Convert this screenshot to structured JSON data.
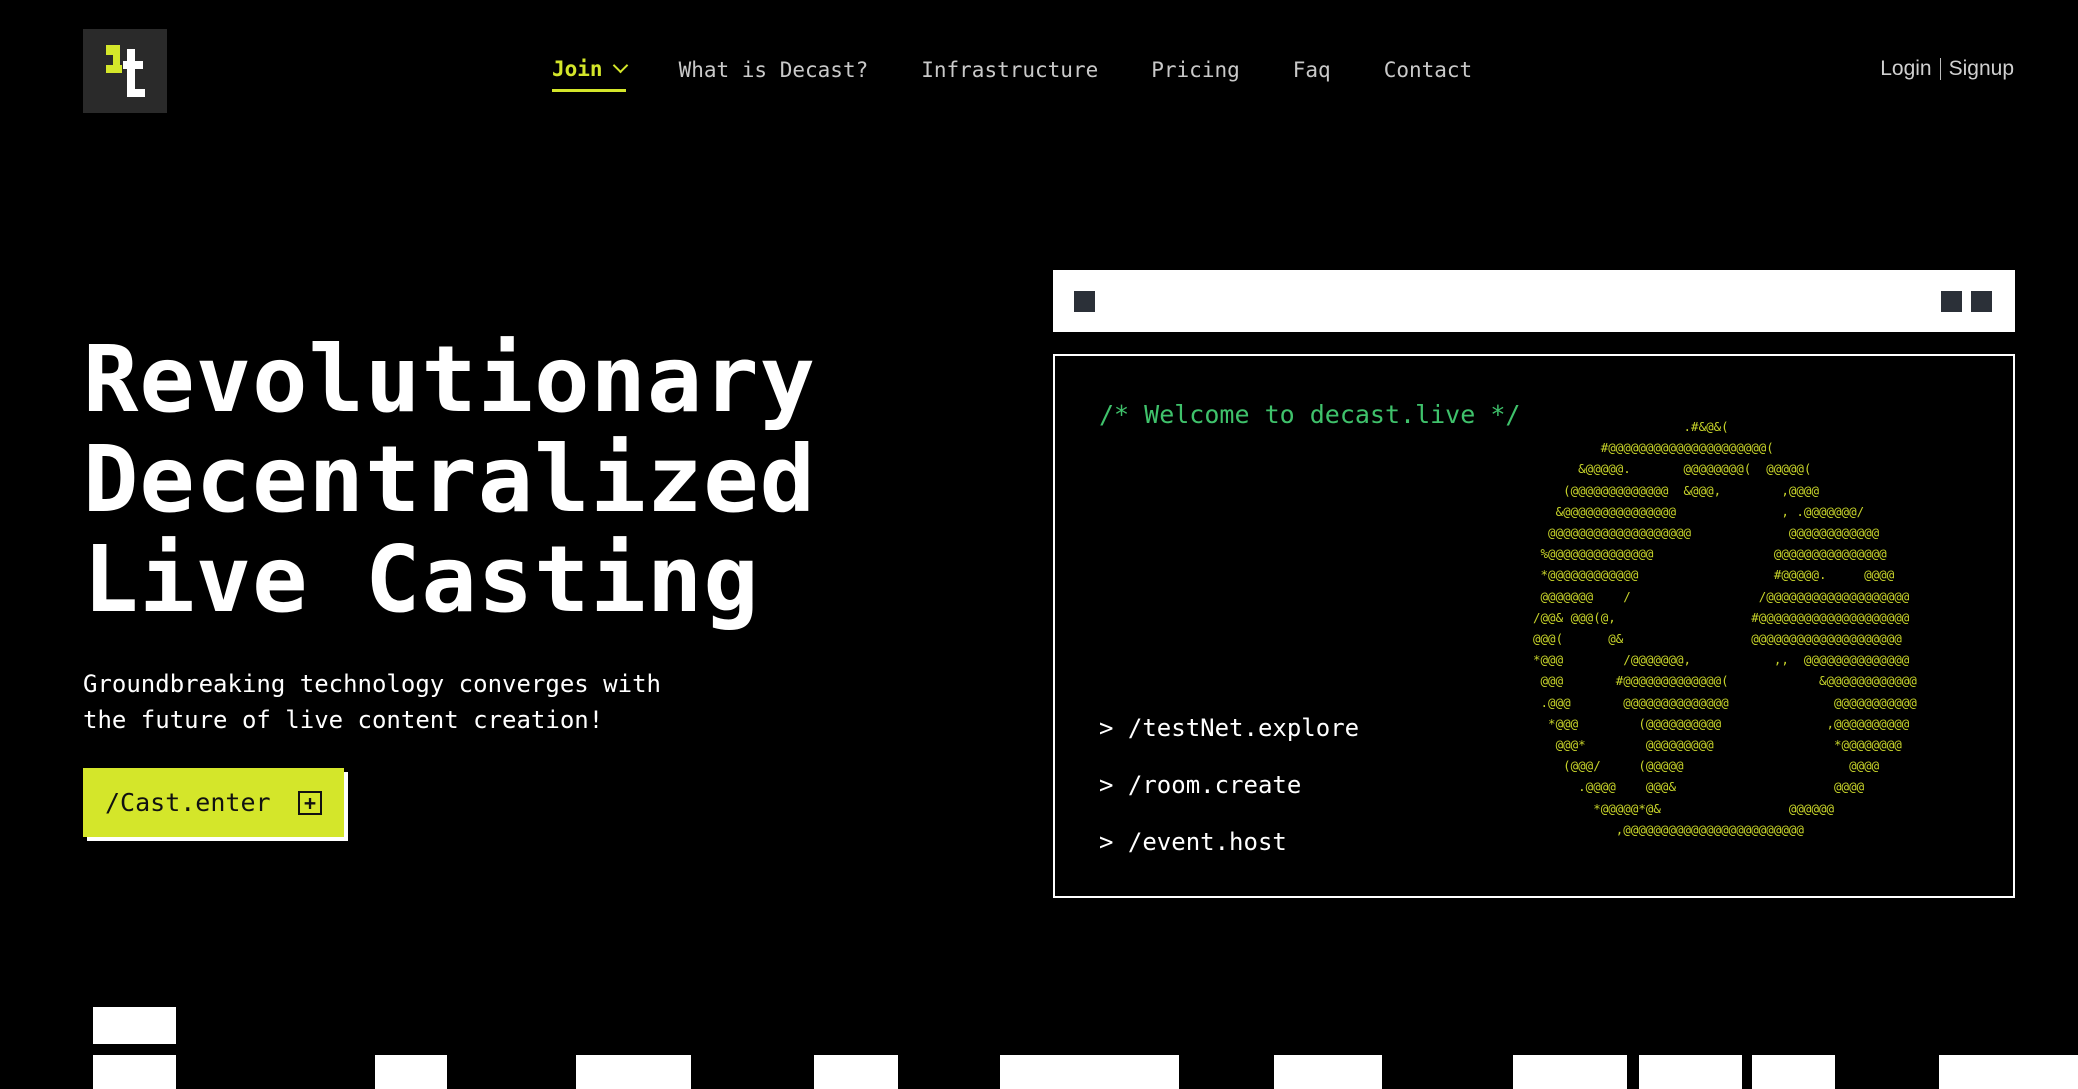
{
  "colors": {
    "background": "#000000",
    "accent": "#d4e62a",
    "terminal_green": "#3fc26b",
    "ascii": "#c8d42a"
  },
  "logo": {
    "icon": "decast-logo-icon"
  },
  "nav": {
    "items": [
      {
        "label": "Join",
        "active": true
      },
      {
        "label": "What is Decast?"
      },
      {
        "label": "Infrastructure"
      },
      {
        "label": "Pricing"
      },
      {
        "label": "Faq"
      },
      {
        "label": "Contact"
      }
    ]
  },
  "auth": {
    "login": "Login",
    "signup": "Signup"
  },
  "hero": {
    "title_lines": [
      "Revolutionary",
      "Decentralized",
      "Live Casting"
    ],
    "subtitle_lines": [
      "Groundbreaking technology converges with",
      "the future of live content creation!"
    ],
    "cta_label": "/Cast.enter",
    "cta_icon": "plus-box-icon"
  },
  "terminal": {
    "welcome": "/* Welcome to decast.live */",
    "commands": [
      "> /testNet.explore",
      "> /room.create",
      "> /event.host"
    ],
    "ascii_art": "                    .#&@&(\n         #@@@@@@@@@@@@@@@@@@@@@(\n      &@@@@@.       @@@@@@@@(  @@@@@(\n    (@@@@@@@@@@@@@  &@@@,        ,@@@@\n   &@@@@@@@@@@@@@@@              , .@@@@@@@/\n  @@@@@@@@@@@@@@@@@@@             @@@@@@@@@@@@\n %@@@@@@@@@@@@@@                @@@@@@@@@@@@@@@\n *@@@@@@@@@@@@                  #@@@@@.     @@@@\n @@@@@@@    /                 /@@@@@@@@@@@@@@@@@@@\n/@@& @@@(@,                  #@@@@@@@@@@@@@@@@@@@@\n@@@(      @&                 @@@@@@@@@@@@@@@@@@@@\n*@@@        /@@@@@@@,           ,,  @@@@@@@@@@@@@@\n @@@       #@@@@@@@@@@@@@(            &@@@@@@@@@@@@\n .@@@       @@@@@@@@@@@@@@              @@@@@@@@@@@\n  *@@@        (@@@@@@@@@@              ,@@@@@@@@@@\n   @@@*        @@@@@@@@@                *@@@@@@@@\n    (@@@/     (@@@@@                      @@@@\n      .@@@@    @@@&                     @@@@\n        *@@@@@*@&                 @@@@@@\n           ,@@@@@@@@@@@@@@@@@@@@@@@@"
  }
}
